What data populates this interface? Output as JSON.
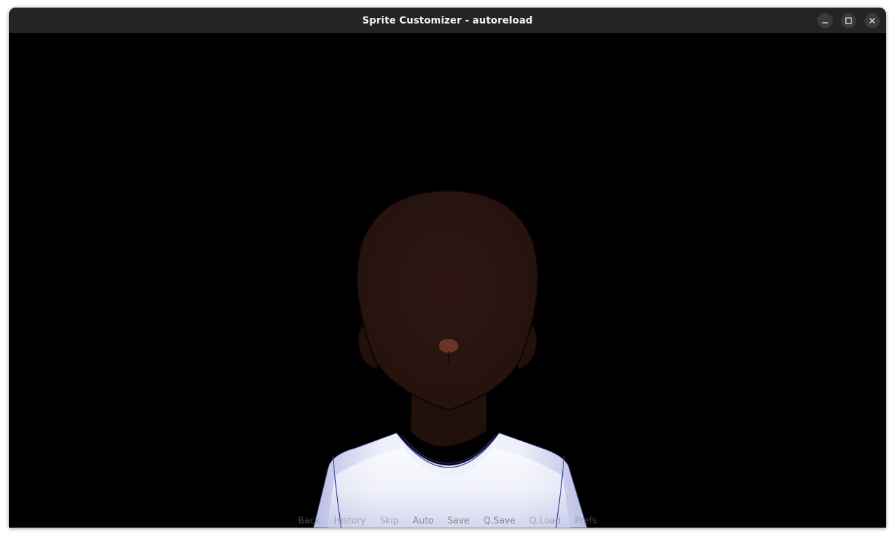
{
  "window": {
    "title": "Sprite Customizer - autoreload"
  },
  "controls": {
    "minimize_icon": "minimize-icon",
    "maximize_icon": "maximize-icon",
    "close_icon": "close-icon"
  },
  "colors": {
    "titlebar": "#242424",
    "background": "#000000",
    "skin": "#2a1510",
    "shirt": "#eef0fa",
    "shirt_seam": "#3a3f8c",
    "nose": "#6b3427"
  },
  "quick_menu": {
    "items": [
      {
        "label": "Back",
        "enabled": false
      },
      {
        "label": "History",
        "enabled": false
      },
      {
        "label": "Skip",
        "enabled": false
      },
      {
        "label": "Auto",
        "enabled": true
      },
      {
        "label": "Save",
        "enabled": true
      },
      {
        "label": "Q.Save",
        "enabled": true
      },
      {
        "label": "Q.Load",
        "enabled": false
      },
      {
        "label": "Prefs",
        "enabled": false
      }
    ]
  }
}
